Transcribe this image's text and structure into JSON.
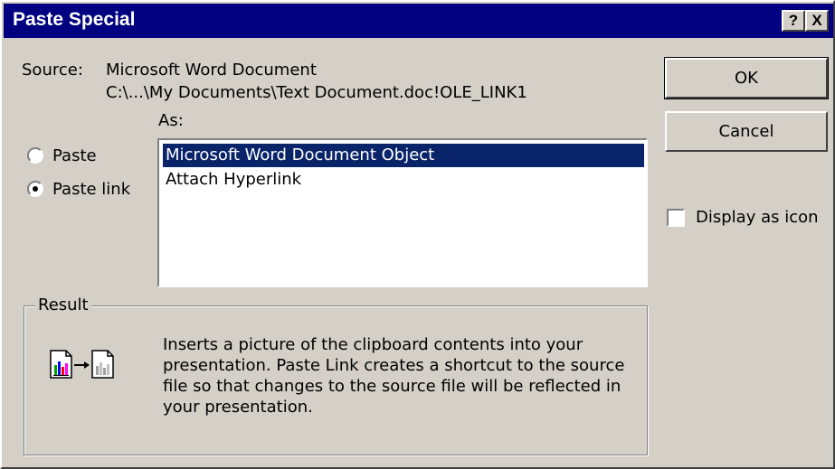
{
  "window": {
    "title": "Paste Special"
  },
  "titlebar": {
    "help_label": "?",
    "close_label": "X"
  },
  "source": {
    "label": "Source:",
    "name": "Microsoft Word Document",
    "path": "C:\\...\\My Documents\\Text Document.doc!OLE_LINK1"
  },
  "as_label": "As:",
  "paste_options": [
    {
      "label": "Paste",
      "selected": false
    },
    {
      "label": "Paste link",
      "selected": true
    }
  ],
  "as_list": [
    {
      "label": "Microsoft Word Document Object",
      "selected": true
    },
    {
      "label": "Attach Hyperlink",
      "selected": false
    }
  ],
  "buttons": {
    "ok": "OK",
    "cancel": "Cancel"
  },
  "display_as_icon": {
    "label": "Display as icon",
    "checked": false
  },
  "result": {
    "label": "Result",
    "text": "Inserts a picture of the clipboard contents into your presentation. Paste Link creates a shortcut to the source file so that changes to the source file will be reflected in your presentation."
  },
  "colors": {
    "titlebar": "#000080",
    "face": "#d4d0c8",
    "selection": "#0a246a"
  }
}
